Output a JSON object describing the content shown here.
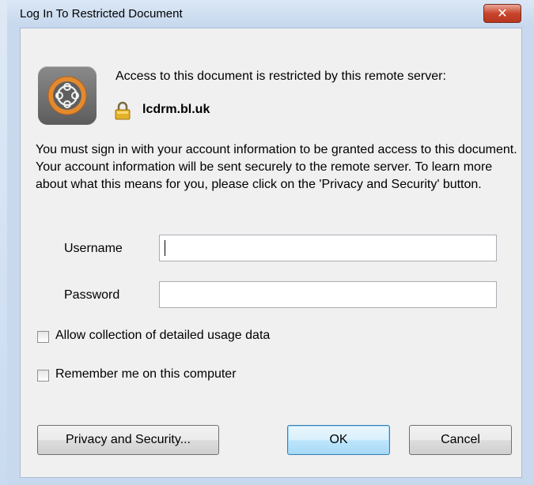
{
  "window": {
    "title": "Log In To Restricted Document",
    "close_symbol": "✕"
  },
  "header": {
    "app_icon": "adobe-livecycle-icon",
    "restricted_message": "Access to this document is restricted by this remote server:",
    "lock_icon": "lock-icon",
    "server_name": "lcdrm.bl.uk"
  },
  "info": {
    "text": "You must sign in with your account information to be granted access to this document. Your account information will be sent securely to the remote server. To learn more about what this means for you, please click on the 'Privacy and Security' button."
  },
  "form": {
    "username_label": "Username",
    "username_value": "",
    "password_label": "Password",
    "password_value": ""
  },
  "options": {
    "usage_data_label": "Allow collection of detailed usage data",
    "usage_data_checked": false,
    "remember_label": "Remember me on this computer",
    "remember_checked": false
  },
  "buttons": {
    "privacy_label": "Privacy and Security...",
    "ok_label": "OK",
    "cancel_label": "Cancel"
  },
  "colors": {
    "title_bar": "#c6d8ee",
    "close_button": "#c8452c",
    "dialog_bg": "#f0f0f0",
    "default_button_border": "#3c7fb1"
  }
}
